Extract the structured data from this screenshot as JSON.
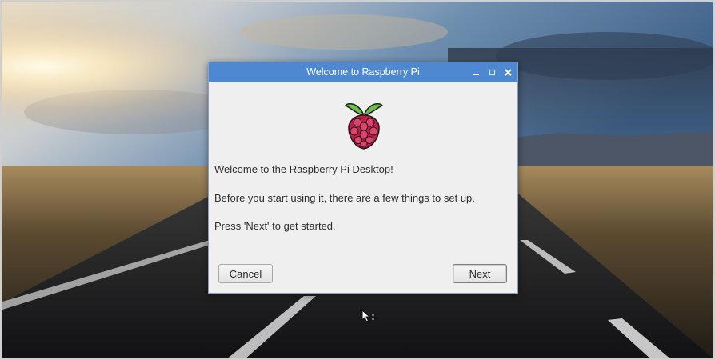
{
  "dialog": {
    "title": "Welcome to Raspberry Pi",
    "logo_icon": "raspberry-pi-logo",
    "lines": [
      "Welcome to the Raspberry Pi Desktop!",
      "Before you start using it, there are a few things to set up.",
      "Press 'Next' to get started."
    ],
    "cancel_label": "Cancel",
    "next_label": "Next",
    "window_controls": [
      "minimize-icon",
      "maximize-icon",
      "close-icon"
    ]
  },
  "colors": {
    "titlebar": "#4d88d1",
    "dialog_bg": "#efefef",
    "text": "#2e2e2e"
  },
  "desktop": {
    "wallpaper": "sunset-road-landscape",
    "cursor": "pointer-busy-cursor"
  }
}
